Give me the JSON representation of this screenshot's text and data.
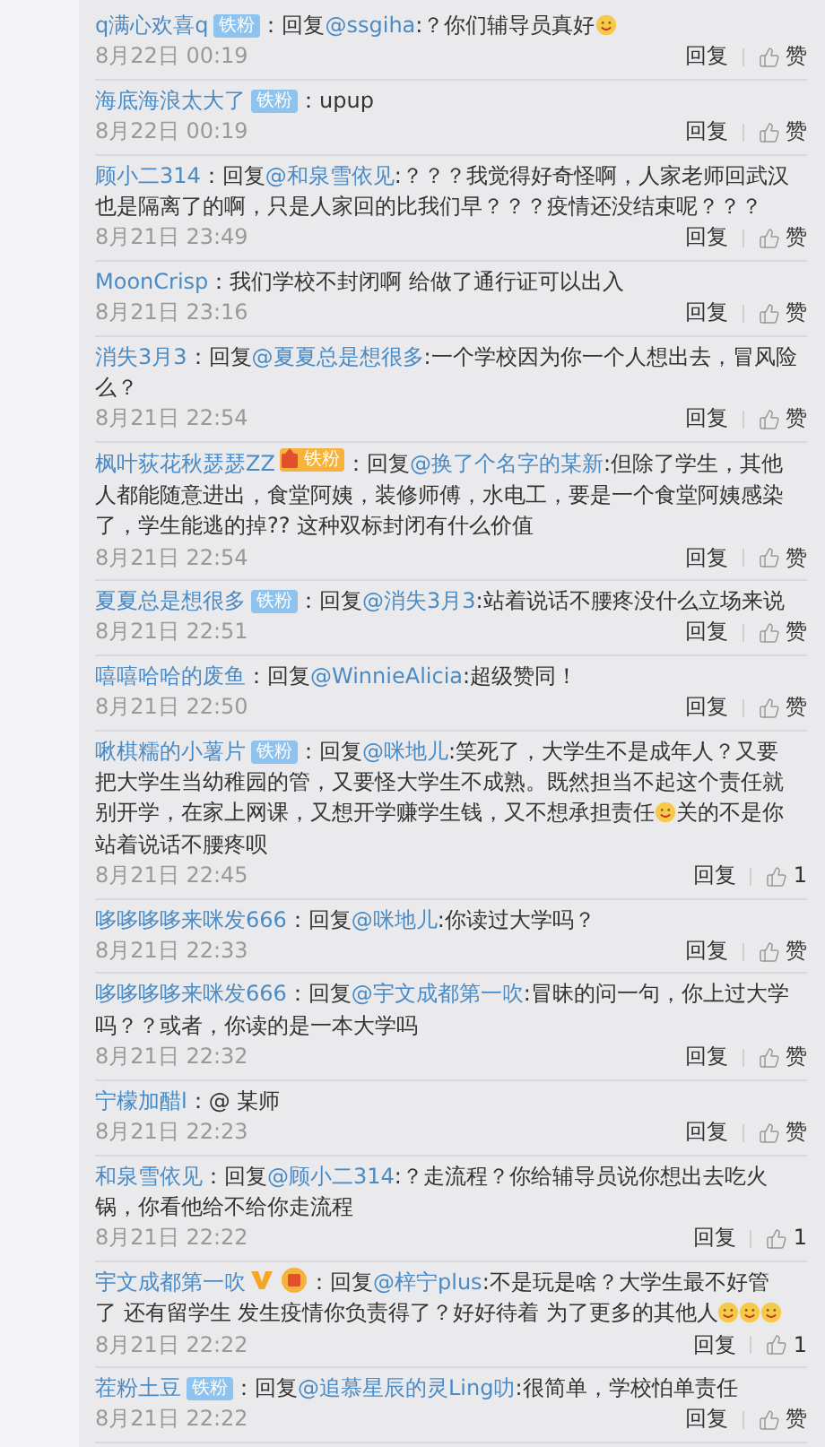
{
  "comments": [
    {
      "user": "q满心欢喜q",
      "badges": [
        {
          "kind": "fan",
          "text": "铁粉"
        }
      ],
      "sep": "：",
      "body": [
        {
          "kind": "text",
          "text": "回复"
        },
        {
          "kind": "mention",
          "text": "@ssgiha"
        },
        {
          "kind": "text",
          "text": ":？你们辅导员真好"
        },
        {
          "kind": "emoji"
        }
      ],
      "time": "8月22日 00:19",
      "reply": "回复",
      "like": "赞"
    },
    {
      "user": "海底海浪太大了",
      "badges": [
        {
          "kind": "fan",
          "text": "铁粉"
        }
      ],
      "sep": "：",
      "body": [
        {
          "kind": "text",
          "text": "upup"
        }
      ],
      "time": "8月22日 00:19",
      "reply": "回复",
      "like": "赞"
    },
    {
      "user": "顾小二314",
      "sep": "：",
      "body": [
        {
          "kind": "text",
          "text": "回复"
        },
        {
          "kind": "mention",
          "text": "@和泉雪依见"
        },
        {
          "kind": "text",
          "text": ":？？？我觉得好奇怪啊，人家老师回武汉也是隔离了的啊，只是人家回的比我们早？？？疫情还没结束呢？？？"
        }
      ],
      "time": "8月21日 23:49",
      "reply": "回复",
      "like": "赞"
    },
    {
      "user": "MoonCrisp",
      "sep": "：",
      "body": [
        {
          "kind": "text",
          "text": "我们学校不封闭啊 给做了通行证可以出入"
        }
      ],
      "time": "8月21日 23:16",
      "reply": "回复",
      "like": "赞"
    },
    {
      "user": "消失3月3",
      "sep": "：",
      "body": [
        {
          "kind": "text",
          "text": "回复"
        },
        {
          "kind": "mention",
          "text": "@夏夏总是想很多"
        },
        {
          "kind": "text",
          "text": ":一个学校因为你一个人想出去，冒风险么？"
        }
      ],
      "time": "8月21日 22:54",
      "reply": "回复",
      "like": "赞"
    },
    {
      "user": "枫叶荻花秋瑟瑟ZZ",
      "badges": [
        {
          "kind": "gold_fan",
          "text": "铁粉"
        }
      ],
      "sep": "：",
      "body": [
        {
          "kind": "text",
          "text": "回复"
        },
        {
          "kind": "mention",
          "text": "@换了个名字的某新"
        },
        {
          "kind": "text",
          "text": ":但除了学生，其他人都能随意进出，食堂阿姨，装修师傅，水电工，要是一个食堂阿姨感染了，学生能逃的掉?? 这种双标封闭有什么价值"
        }
      ],
      "time": "8月21日 22:54",
      "reply": "回复",
      "like": "赞"
    },
    {
      "user": "夏夏总是想很多",
      "badges": [
        {
          "kind": "fan",
          "text": "铁粉"
        }
      ],
      "sep": "：",
      "body": [
        {
          "kind": "text",
          "text": "回复"
        },
        {
          "kind": "mention",
          "text": "@消失3月3"
        },
        {
          "kind": "text",
          "text": ":站着说话不腰疼没什么立场来说"
        }
      ],
      "time": "8月21日 22:51",
      "reply": "回复",
      "like": "赞"
    },
    {
      "user": "嘻嘻哈哈的废鱼",
      "sep": "：",
      "body": [
        {
          "kind": "text",
          "text": "回复"
        },
        {
          "kind": "mention",
          "text": "@WinnieAlicia"
        },
        {
          "kind": "text",
          "text": ":超级赞同！"
        }
      ],
      "time": "8月21日 22:50",
      "reply": "回复",
      "like": "赞"
    },
    {
      "user": "啾棋糯的小薯片",
      "badges": [
        {
          "kind": "fan",
          "text": "铁粉"
        }
      ],
      "sep": "：",
      "body": [
        {
          "kind": "text",
          "text": "回复"
        },
        {
          "kind": "mention",
          "text": "@咪地儿"
        },
        {
          "kind": "text",
          "text": ":笑死了，大学生不是成年人？又要把大学生当幼稚园的管，又要怪大学生不成熟。既然担当不起这个责任就别开学，在家上网课，又想开学赚学生钱，又不想承担责任"
        },
        {
          "kind": "emoji"
        },
        {
          "kind": "text",
          "text": "关的不是你站着说话不腰疼呗"
        }
      ],
      "time": "8月21日 22:45",
      "reply": "回复",
      "like": "1"
    },
    {
      "user": "哆哆哆哆来咪发666",
      "sep": "：",
      "body": [
        {
          "kind": "text",
          "text": "回复"
        },
        {
          "kind": "mention",
          "text": "@咪地儿"
        },
        {
          "kind": "text",
          "text": ":你读过大学吗？"
        }
      ],
      "time": "8月21日 22:33",
      "reply": "回复",
      "like": "赞"
    },
    {
      "user": "哆哆哆哆来咪发666",
      "sep": "：",
      "body": [
        {
          "kind": "text",
          "text": "回复"
        },
        {
          "kind": "mention",
          "text": "@宇文成都第一吹"
        },
        {
          "kind": "text",
          "text": ":冒昧的问一句，你上过大学吗？？或者，你读的是一本大学吗"
        }
      ],
      "time": "8月21日 22:32",
      "reply": "回复",
      "like": "赞"
    },
    {
      "user": "宁檬加醋l",
      "sep": "：",
      "body": [
        {
          "kind": "text",
          "text": "@ 某师"
        }
      ],
      "time": "8月21日 22:23",
      "reply": "回复",
      "like": "赞"
    },
    {
      "user": "和泉雪依见",
      "sep": "：",
      "body": [
        {
          "kind": "text",
          "text": "回复"
        },
        {
          "kind": "mention",
          "text": "@顾小二314"
        },
        {
          "kind": "text",
          "text": ":？走流程？你给辅导员说你想出去吃火锅，你看他给不给你走流程"
        }
      ],
      "time": "8月21日 22:22",
      "reply": "回复",
      "like": "1"
    },
    {
      "user": "宇文成都第一吹",
      "badges": [
        {
          "kind": "verified"
        },
        {
          "kind": "gold"
        }
      ],
      "sep": "：",
      "body": [
        {
          "kind": "text",
          "text": "回复"
        },
        {
          "kind": "mention",
          "text": "@梓宁plus"
        },
        {
          "kind": "text",
          "text": ":不是玩是啥？大学生最不好管"
        },
        {
          "kind": "break"
        },
        {
          "kind": "text",
          "text": "了  还有留学生  发生疫情你负责得了？好好待着 为了更多的其他人"
        },
        {
          "kind": "emoji"
        },
        {
          "kind": "emoji"
        },
        {
          "kind": "emoji"
        }
      ],
      "time": "8月21日 22:22",
      "reply": "回复",
      "like": "1"
    },
    {
      "user": "茬粉土豆",
      "badges": [
        {
          "kind": "fan",
          "text": "铁粉"
        }
      ],
      "sep": "：",
      "body": [
        {
          "kind": "text",
          "text": "回复"
        },
        {
          "kind": "mention",
          "text": "@追慕星辰的灵Ling叻"
        },
        {
          "kind": "text",
          "text": ":很简单，学校怕单责任"
        }
      ],
      "time": "8月21日 22:22",
      "reply": "回复",
      "like": "赞"
    }
  ]
}
